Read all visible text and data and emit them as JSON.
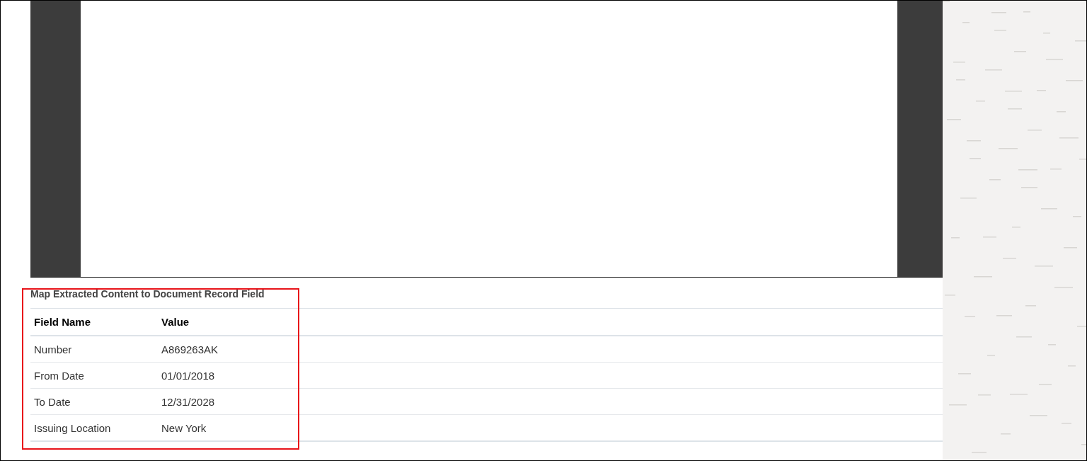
{
  "section": {
    "title": "Map Extracted Content to Document Record Field"
  },
  "table": {
    "columns": [
      "Field Name",
      "Value"
    ],
    "rows": [
      {
        "field": "Number",
        "value": "A869263AK"
      },
      {
        "field": "From Date",
        "value": "01/01/2018"
      },
      {
        "field": "To Date",
        "value": "12/31/2028"
      },
      {
        "field": "Issuing Location",
        "value": "New York"
      }
    ]
  }
}
